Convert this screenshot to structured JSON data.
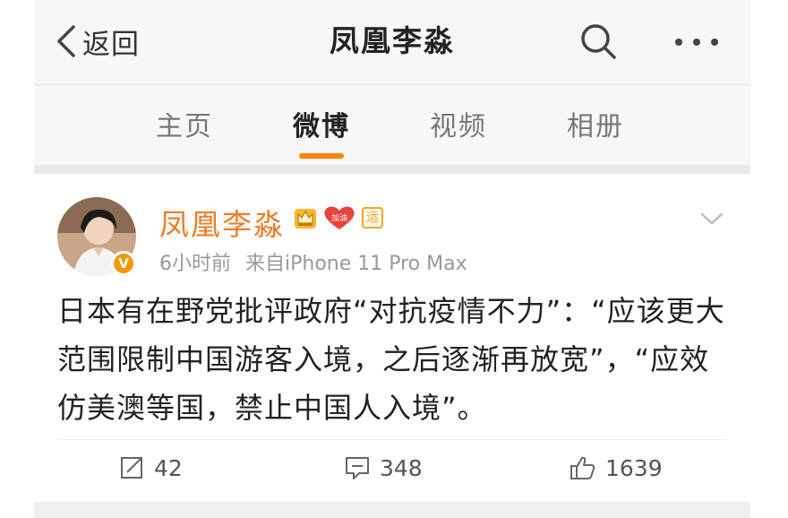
{
  "topbar": {
    "back_label": "返回",
    "title": "凤凰李淼",
    "icons": [
      "chevron-left-icon",
      "search-icon",
      "more-icon"
    ]
  },
  "tabs": [
    {
      "label": "主页",
      "active": false
    },
    {
      "label": "微博",
      "active": true
    },
    {
      "label": "视频",
      "active": false
    },
    {
      "label": "相册",
      "active": false
    }
  ],
  "post": {
    "author": "凤凰李淼",
    "verified_mark": "V",
    "badges": {
      "heart_label": "加油",
      "yun_label": "运"
    },
    "time": "6小时前",
    "source": "来自iPhone 11 Pro Max",
    "text": "日本有在野党批评政府“对抗疫情不力”：“应该更大范围限制中国游客入境，之后逐渐再放宽”，“应效仿美澳等国，禁止中国人入境”。",
    "actions": {
      "repost_count": "42",
      "comment_count": "348",
      "like_count": "1639"
    }
  },
  "colors": {
    "accent": "#ff8200",
    "username": "#f07c23",
    "verified": "#f39800"
  }
}
